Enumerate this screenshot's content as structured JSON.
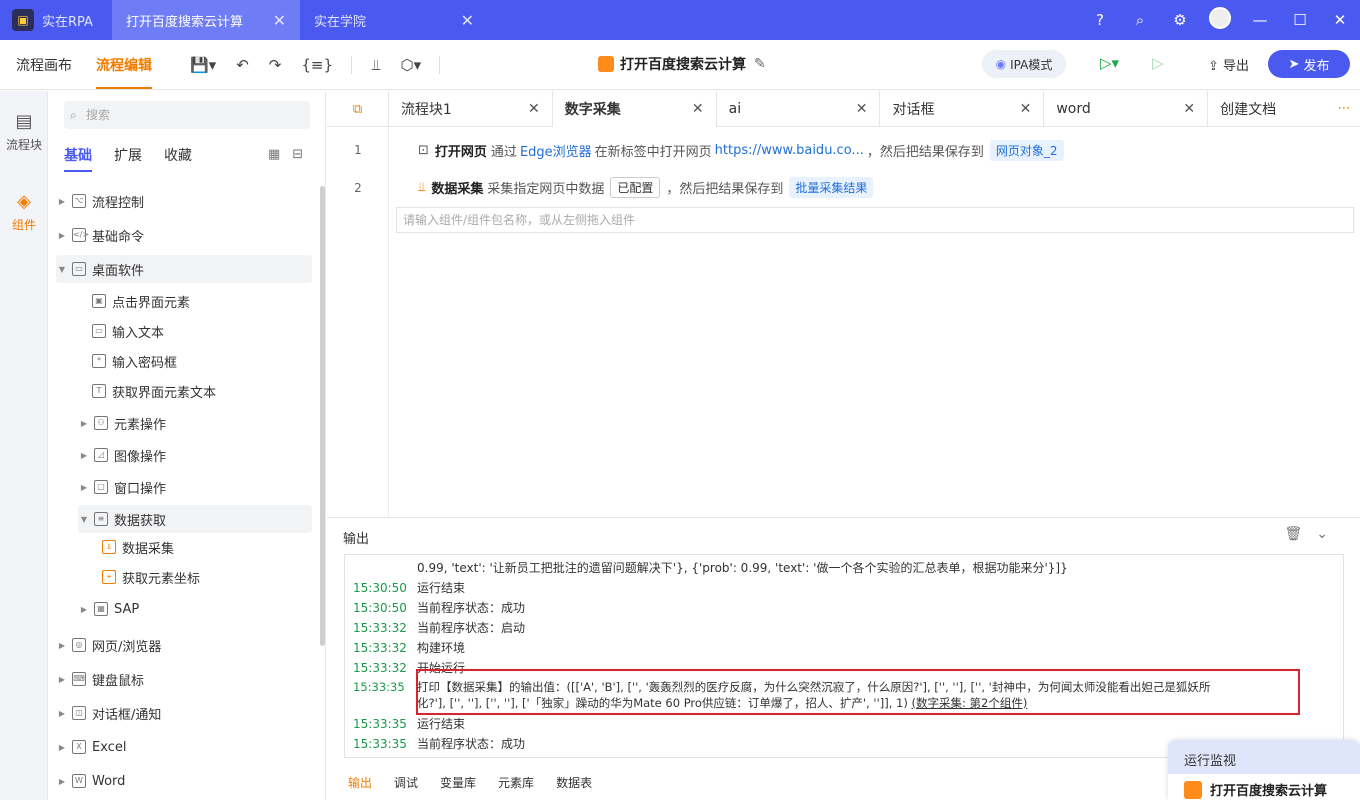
{
  "titlebar": {
    "tabs": [
      {
        "label": "实在RPA"
      },
      {
        "label": "打开百度搜索云计算"
      },
      {
        "label": "实在学院"
      }
    ],
    "icons": [
      "help-icon",
      "search-icon",
      "settings-icon",
      "avatar",
      "minimize-icon",
      "maximize-icon",
      "close-icon"
    ]
  },
  "toolbar": {
    "canvas": "流程画布",
    "edit": "流程编辑",
    "doc_title": "打开百度搜索云计算",
    "ipa_mode": "IPA模式",
    "export": "导出",
    "publish": "发布"
  },
  "leftbar": {
    "blocks": "流程块",
    "components": "组件"
  },
  "panel": {
    "search_placeholder": "搜索",
    "tabs": [
      "基础",
      "扩展",
      "收藏"
    ],
    "tree": [
      {
        "label": "流程控制"
      },
      {
        "label": "基础命令"
      },
      {
        "label": "桌面软件"
      },
      {
        "label": "点击界面元素"
      },
      {
        "label": "输入文本"
      },
      {
        "label": "输入密码框"
      },
      {
        "label": "获取界面元素文本"
      },
      {
        "label": "元素操作"
      },
      {
        "label": "图像操作"
      },
      {
        "label": "窗口操作"
      },
      {
        "label": "数据获取"
      },
      {
        "label": "数据采集"
      },
      {
        "label": "获取元素坐标"
      },
      {
        "label": "SAP"
      },
      {
        "label": "网页/浏览器"
      },
      {
        "label": "键盘鼠标"
      },
      {
        "label": "对话框/通知"
      },
      {
        "label": "Excel"
      },
      {
        "label": "Word"
      }
    ]
  },
  "editor": {
    "tabs": [
      "流程块1",
      "数字采集",
      "ai",
      "对话框",
      "word",
      "创建文档"
    ],
    "steps": [
      {
        "num": "1",
        "name": "打开网页",
        "t1": "通过",
        "browser": "Edge浏览器",
        "t2": "在新标签中打开网页",
        "url": "https://www.baidu.co...",
        "t3": "，然后把结果保存到",
        "var": "网页对象_2"
      },
      {
        "num": "2",
        "name": "数据采集",
        "t1": "采集指定网页中数据",
        "cfg": "已配置",
        "t2": "，然后把结果保存到",
        "var": "批量采集结果"
      }
    ],
    "add_placeholder": "请输入组件/组件包名称，或从左侧拖入组件"
  },
  "output": {
    "title": "输出",
    "logs": [
      {
        "time": "",
        "text": "0.99, 'text': '让新员工把批注的遗留问题解决下'}, {'prob': 0.99, 'text': '做一个各个实验的汇总表单，根据功能来分'}]}"
      },
      {
        "time": "15:30:50",
        "text": "运行结束"
      },
      {
        "time": "15:30:50",
        "text": "当前程序状态：成功"
      },
      {
        "time": "15:33:32",
        "text": "当前程序状态：启动"
      },
      {
        "time": "15:33:32",
        "text": "构建环境"
      },
      {
        "time": "15:33:32",
        "text": "开始运行"
      },
      {
        "time": "15:33:35",
        "text": "打印【数据采集】的输出值：([['A', 'B'], ['', '轰轰烈烈的医疗反腐，为什么突然沉寂了，什么原因?'], ['', ''], ['', '封神中，为何闻太师没能看出妲己是狐妖所"
      },
      {
        "time": "",
        "text": "化?'], ['', ''], ['', ''], ['「独家」躁动的华为Mate 60 Pro供应链：订单爆了，招人、扩产', '']], 1)"
      },
      {
        "time": "15:33:35",
        "text": "运行结束"
      },
      {
        "time": "15:33:35",
        "text": "当前程序状态：成功"
      }
    ],
    "link": "(数字采集: 第2个组件)",
    "bottom_tabs": [
      "输出",
      "调试",
      "变量库",
      "元素库",
      "数据表"
    ]
  },
  "monitor": {
    "title": "运行监视",
    "name": "打开百度搜索云计算"
  }
}
